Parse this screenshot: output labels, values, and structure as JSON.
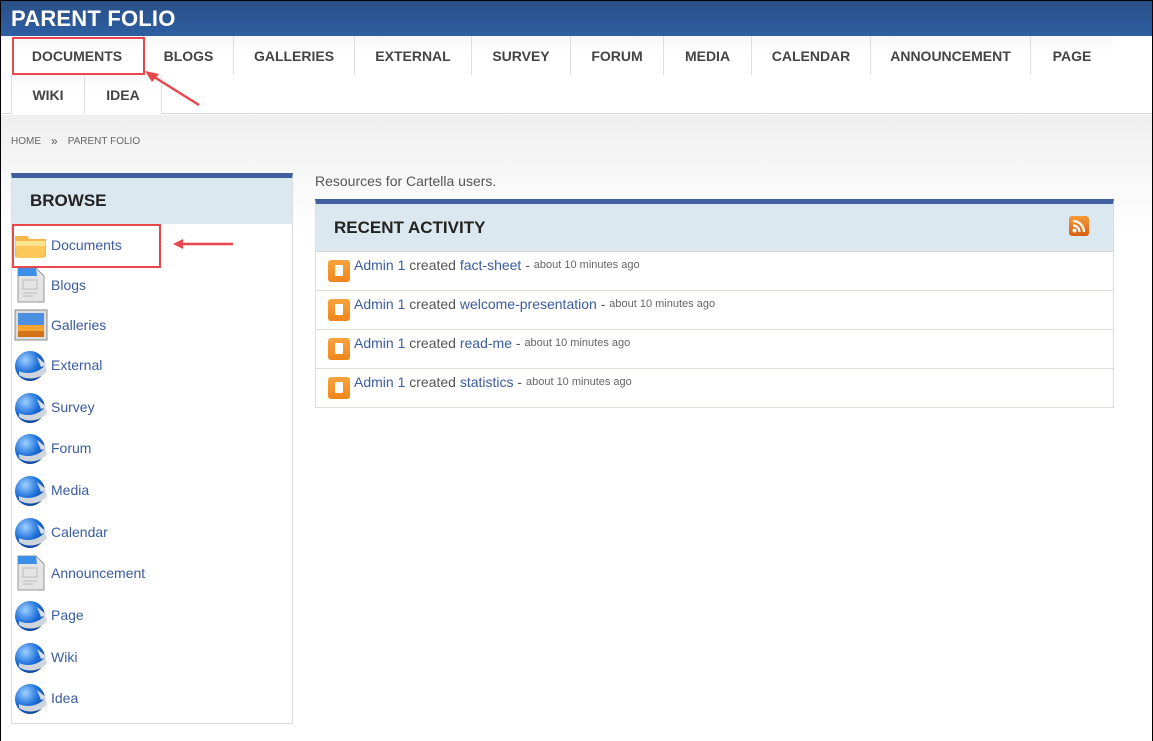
{
  "site": {
    "title": "PARENT FOLIO"
  },
  "nav": {
    "row1": [
      "DOCUMENTS",
      "BLOGS",
      "GALLERIES",
      "EXTERNAL",
      "SURVEY",
      "FORUM",
      "MEDIA",
      "CALENDAR",
      "ANNOUNCEMENT",
      "PAGE"
    ],
    "row2": [
      "WIKI",
      "IDEA"
    ],
    "highlighted": "DOCUMENTS"
  },
  "breadcrumb": {
    "home": "HOME",
    "separator": "»",
    "current": "PARENT FOLIO"
  },
  "browse": {
    "title": "BROWSE",
    "items": [
      {
        "label": "Documents",
        "icon": "folder-icon"
      },
      {
        "label": "Blogs",
        "icon": "document-page-icon"
      },
      {
        "label": "Galleries",
        "icon": "picture-icon"
      },
      {
        "label": "External",
        "icon": "globe-arrow-icon"
      },
      {
        "label": "Survey",
        "icon": "globe-arrow-icon"
      },
      {
        "label": "Forum",
        "icon": "globe-arrow-icon"
      },
      {
        "label": "Media",
        "icon": "globe-arrow-icon"
      },
      {
        "label": "Calendar",
        "icon": "globe-arrow-icon"
      },
      {
        "label": "Announcement",
        "icon": "document-page-icon"
      },
      {
        "label": "Page",
        "icon": "globe-arrow-icon"
      },
      {
        "label": "Wiki",
        "icon": "globe-arrow-icon"
      },
      {
        "label": "Idea",
        "icon": "globe-arrow-icon"
      }
    ]
  },
  "main": {
    "intro": "Resources for Cartella users.",
    "activity": {
      "title": "RECENT ACTIVITY",
      "rss_icon": "rss-icon",
      "rows": [
        {
          "user": "Admin 1",
          "verb": "created",
          "item": "fact-sheet",
          "dash": " - ",
          "time": "about 10 minutes ago"
        },
        {
          "user": "Admin 1",
          "verb": "created",
          "item": "welcome-presentation",
          "dash": " - ",
          "time": "about 10 minutes ago"
        },
        {
          "user": "Admin 1",
          "verb": "created",
          "item": "read-me",
          "dash": " - ",
          "time": "about 10 minutes ago"
        },
        {
          "user": "Admin 1",
          "verb": "created",
          "item": "statistics",
          "dash": " - ",
          "time": "about 10 minutes ago"
        }
      ]
    }
  },
  "colors": {
    "header": "#2d5fa3",
    "accent_bar": "#3f5f9e",
    "panel_head": "#dce8f0",
    "link": "#3a5ca0",
    "highlight": "#e8474c",
    "rss": "#f08a24"
  }
}
